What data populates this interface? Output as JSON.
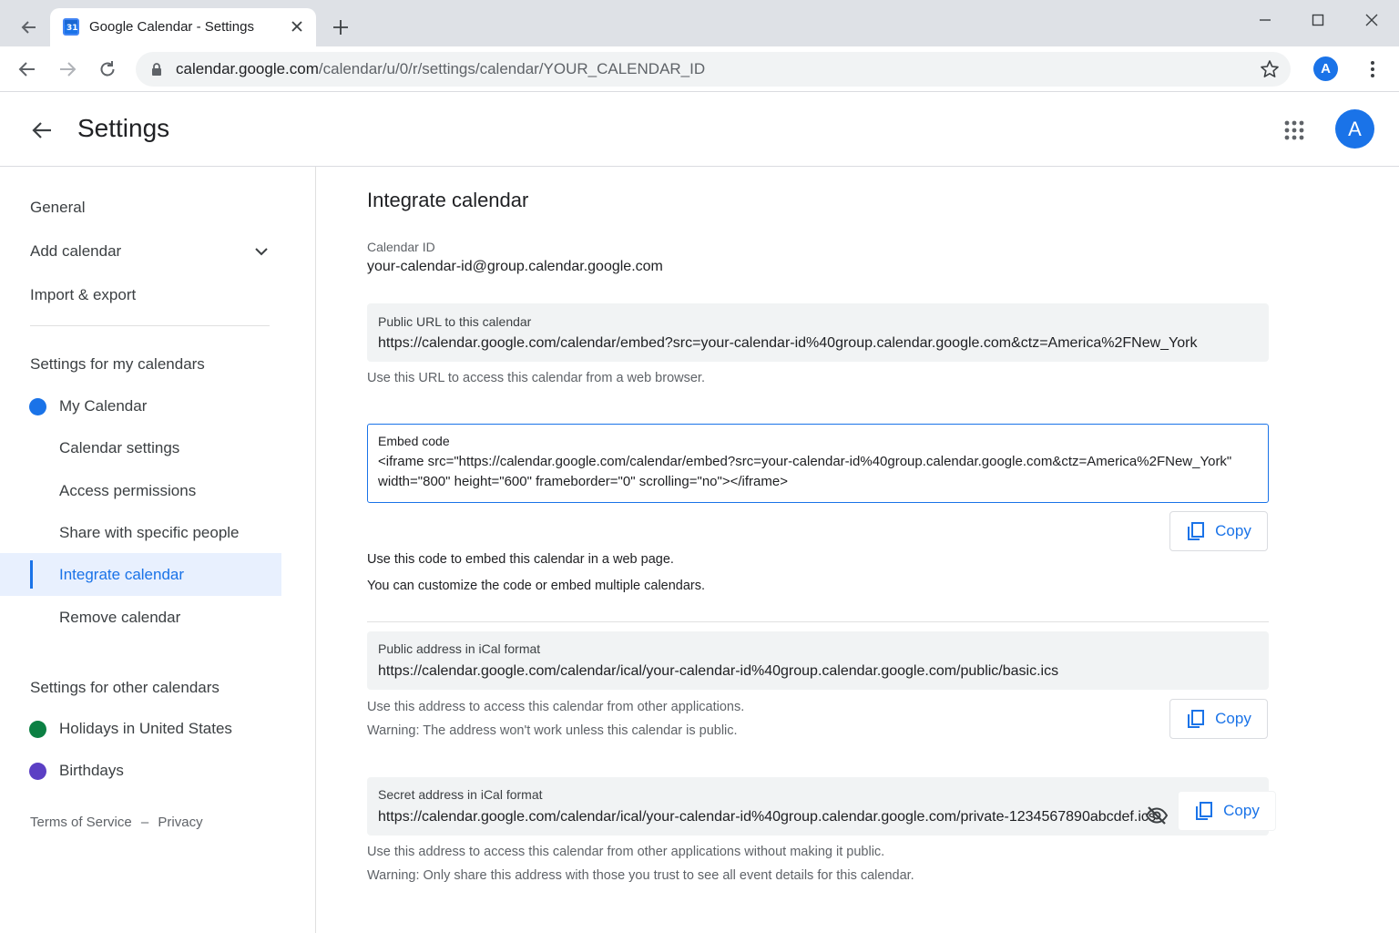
{
  "browser": {
    "tab_title": "Google Calendar - Settings",
    "favicon_text": "31",
    "url_host": "calendar.google.com",
    "url_path": "/calendar/u/0/r/settings/calendar/YOUR_CALENDAR_ID",
    "profile_initial": "A"
  },
  "header": {
    "title": "Settings",
    "avatar_initial": "A"
  },
  "sidebar": {
    "general": "General",
    "add_calendar": "Add calendar",
    "import_export": "Import & export",
    "my_calendars_heading": "Settings for my calendars",
    "my_calendar": {
      "name": "My Calendar",
      "color": "#1a73e8"
    },
    "sub_items": [
      "Calendar settings",
      "Access permissions",
      "Share with specific people",
      "Integrate calendar",
      "Remove calendar"
    ],
    "active_item": "Integrate calendar",
    "other_calendars_heading": "Settings for other calendars",
    "other_calendars": [
      {
        "name": "Holidays in United States",
        "color": "#0b8043"
      },
      {
        "name": "Birthdays",
        "color": "#5b3fc4"
      }
    ],
    "footer": {
      "terms": "Terms of Service",
      "separator": "–",
      "privacy": "Privacy"
    }
  },
  "main": {
    "section_title": "Integrate calendar",
    "calendar_id_label": "Calendar ID",
    "calendar_id_value": "your-calendar-id@group.calendar.google.com",
    "public_url": {
      "label": "Public URL to this calendar",
      "value": "https://calendar.google.com/calendar/embed?src=your-calendar-id%40group.calendar.google.com&ctz=America%2FNew_York",
      "help": "Use this URL to access this calendar from a web browser."
    },
    "embed": {
      "label": "Embed code",
      "code_line1": "<iframe src=\"https://calendar.google.com/calendar/embed?src=your-calendar-id%40group.calendar.google.com&ctz=America%2FNew_York\"",
      "code_line2": "width=\"800\" height=\"600\" frameborder=\"0\" scrolling=\"no\"></iframe>",
      "help1": "Use this code to embed this calendar in a web page.",
      "help2": "You can customize the code or embed multiple calendars."
    },
    "ical_public": {
      "label": "Public address in iCal format",
      "value": "https://calendar.google.com/calendar/ical/your-calendar-id%40group.calendar.google.com/public/basic.ics",
      "help1": "Use this address to access this calendar from other applications.",
      "help2": "Warning: The address won't work unless this calendar is public."
    },
    "ical_secret": {
      "label": "Secret address in iCal format",
      "value": "https://calendar.google.com/calendar/ical/your-calendar-id%40group.calendar.google.com/private-1234567890abcdef.ics",
      "help1": "Use this address to access this calendar from other applications without making it public.",
      "help2": "Warning: Only share this address with those you trust to see all event details for this calendar."
    },
    "copy_label": "Copy",
    "accent_color": "#1a73e8"
  }
}
